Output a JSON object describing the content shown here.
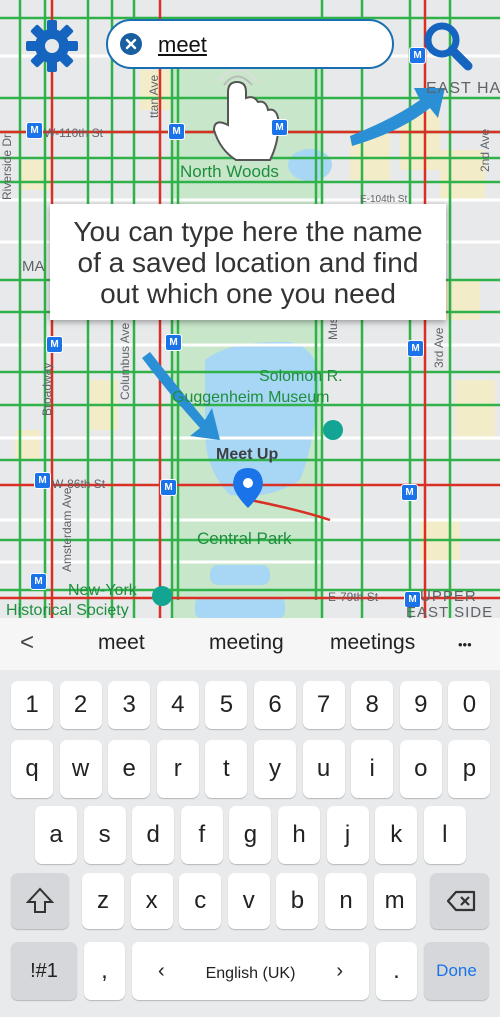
{
  "search": {
    "query": "meet"
  },
  "tooltip": {
    "lines": [
      "You can type here the name",
      "of a saved location and find",
      "out which one you need"
    ]
  },
  "map": {
    "pin_label": "Meet Up",
    "parks": {
      "north_woods": "North Woods",
      "central_park": "Central Park",
      "museum_line1": "Solomon R.",
      "museum_line2": "Guggenheim Museum"
    },
    "places": {
      "nyhs_line1": "New-York",
      "nyhs_line2": "Historical Society"
    },
    "neighborhoods": {
      "east_harlem": "EAST HA",
      "upper_east_side_1": "UPPER",
      "upper_east_side_2": "EAST SIDE",
      "ma": "MA"
    },
    "streets": {
      "w110": "W-110th St",
      "w86": "W-86th St",
      "e79": "E-79th St",
      "e104": "E-104th St",
      "manhattan_ave": "ttan Ave",
      "columbus_ave": "Columbus Ave",
      "amsterdam_ave": "Amsterdam Ave",
      "broadway": "Broadway",
      "riverside_dr": "Riverside Dr",
      "second_ave": "2nd Ave",
      "third_ave": "3rd Ave",
      "madison": "Mus"
    },
    "metro_glyph": "M"
  },
  "keyboard": {
    "suggestions": [
      "meet",
      "meeting",
      "meetings"
    ],
    "back_glyph": "<",
    "more_glyph": "•••",
    "number_row": [
      "1",
      "2",
      "3",
      "4",
      "5",
      "6",
      "7",
      "8",
      "9",
      "0"
    ],
    "row1": [
      "q",
      "w",
      "e",
      "r",
      "t",
      "y",
      "u",
      "i",
      "o",
      "p"
    ],
    "row2": [
      "a",
      "s",
      "d",
      "f",
      "g",
      "h",
      "j",
      "k",
      "l"
    ],
    "row3": [
      "z",
      "x",
      "c",
      "v",
      "b",
      "n",
      "m"
    ],
    "symbols_key": "!#1",
    "comma_key": ",",
    "space_label": "English (UK)",
    "space_left": "‹",
    "space_right": "›",
    "period_key": ".",
    "done_key": "Done"
  },
  "colors": {
    "accent": "#1a73e8",
    "search_border": "#1a6fb0",
    "park": "#c8e6c9",
    "water": "#a8d6f5",
    "road_green": "#2fb24a",
    "road_red": "#d93025",
    "arrow": "#2b8fd6"
  }
}
